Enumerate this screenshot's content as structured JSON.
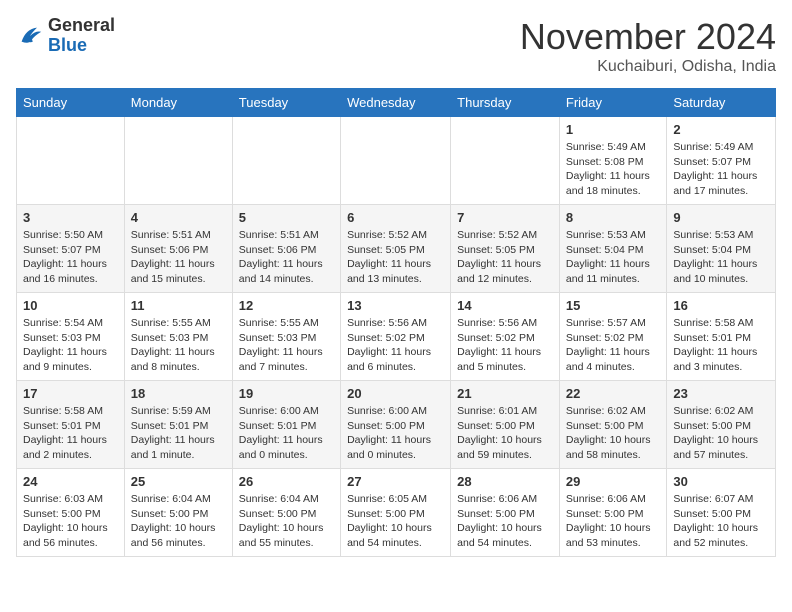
{
  "header": {
    "logo_general": "General",
    "logo_blue": "Blue",
    "month": "November 2024",
    "location": "Kuchaiburi, Odisha, India"
  },
  "days_of_week": [
    "Sunday",
    "Monday",
    "Tuesday",
    "Wednesday",
    "Thursday",
    "Friday",
    "Saturday"
  ],
  "weeks": [
    [
      {
        "day": "",
        "info": ""
      },
      {
        "day": "",
        "info": ""
      },
      {
        "day": "",
        "info": ""
      },
      {
        "day": "",
        "info": ""
      },
      {
        "day": "",
        "info": ""
      },
      {
        "day": "1",
        "info": "Sunrise: 5:49 AM\nSunset: 5:08 PM\nDaylight: 11 hours and 18 minutes."
      },
      {
        "day": "2",
        "info": "Sunrise: 5:49 AM\nSunset: 5:07 PM\nDaylight: 11 hours and 17 minutes."
      }
    ],
    [
      {
        "day": "3",
        "info": "Sunrise: 5:50 AM\nSunset: 5:07 PM\nDaylight: 11 hours and 16 minutes."
      },
      {
        "day": "4",
        "info": "Sunrise: 5:51 AM\nSunset: 5:06 PM\nDaylight: 11 hours and 15 minutes."
      },
      {
        "day": "5",
        "info": "Sunrise: 5:51 AM\nSunset: 5:06 PM\nDaylight: 11 hours and 14 minutes."
      },
      {
        "day": "6",
        "info": "Sunrise: 5:52 AM\nSunset: 5:05 PM\nDaylight: 11 hours and 13 minutes."
      },
      {
        "day": "7",
        "info": "Sunrise: 5:52 AM\nSunset: 5:05 PM\nDaylight: 11 hours and 12 minutes."
      },
      {
        "day": "8",
        "info": "Sunrise: 5:53 AM\nSunset: 5:04 PM\nDaylight: 11 hours and 11 minutes."
      },
      {
        "day": "9",
        "info": "Sunrise: 5:53 AM\nSunset: 5:04 PM\nDaylight: 11 hours and 10 minutes."
      }
    ],
    [
      {
        "day": "10",
        "info": "Sunrise: 5:54 AM\nSunset: 5:03 PM\nDaylight: 11 hours and 9 minutes."
      },
      {
        "day": "11",
        "info": "Sunrise: 5:55 AM\nSunset: 5:03 PM\nDaylight: 11 hours and 8 minutes."
      },
      {
        "day": "12",
        "info": "Sunrise: 5:55 AM\nSunset: 5:03 PM\nDaylight: 11 hours and 7 minutes."
      },
      {
        "day": "13",
        "info": "Sunrise: 5:56 AM\nSunset: 5:02 PM\nDaylight: 11 hours and 6 minutes."
      },
      {
        "day": "14",
        "info": "Sunrise: 5:56 AM\nSunset: 5:02 PM\nDaylight: 11 hours and 5 minutes."
      },
      {
        "day": "15",
        "info": "Sunrise: 5:57 AM\nSunset: 5:02 PM\nDaylight: 11 hours and 4 minutes."
      },
      {
        "day": "16",
        "info": "Sunrise: 5:58 AM\nSunset: 5:01 PM\nDaylight: 11 hours and 3 minutes."
      }
    ],
    [
      {
        "day": "17",
        "info": "Sunrise: 5:58 AM\nSunset: 5:01 PM\nDaylight: 11 hours and 2 minutes."
      },
      {
        "day": "18",
        "info": "Sunrise: 5:59 AM\nSunset: 5:01 PM\nDaylight: 11 hours and 1 minute."
      },
      {
        "day": "19",
        "info": "Sunrise: 6:00 AM\nSunset: 5:01 PM\nDaylight: 11 hours and 0 minutes."
      },
      {
        "day": "20",
        "info": "Sunrise: 6:00 AM\nSunset: 5:00 PM\nDaylight: 11 hours and 0 minutes."
      },
      {
        "day": "21",
        "info": "Sunrise: 6:01 AM\nSunset: 5:00 PM\nDaylight: 10 hours and 59 minutes."
      },
      {
        "day": "22",
        "info": "Sunrise: 6:02 AM\nSunset: 5:00 PM\nDaylight: 10 hours and 58 minutes."
      },
      {
        "day": "23",
        "info": "Sunrise: 6:02 AM\nSunset: 5:00 PM\nDaylight: 10 hours and 57 minutes."
      }
    ],
    [
      {
        "day": "24",
        "info": "Sunrise: 6:03 AM\nSunset: 5:00 PM\nDaylight: 10 hours and 56 minutes."
      },
      {
        "day": "25",
        "info": "Sunrise: 6:04 AM\nSunset: 5:00 PM\nDaylight: 10 hours and 56 minutes."
      },
      {
        "day": "26",
        "info": "Sunrise: 6:04 AM\nSunset: 5:00 PM\nDaylight: 10 hours and 55 minutes."
      },
      {
        "day": "27",
        "info": "Sunrise: 6:05 AM\nSunset: 5:00 PM\nDaylight: 10 hours and 54 minutes."
      },
      {
        "day": "28",
        "info": "Sunrise: 6:06 AM\nSunset: 5:00 PM\nDaylight: 10 hours and 54 minutes."
      },
      {
        "day": "29",
        "info": "Sunrise: 6:06 AM\nSunset: 5:00 PM\nDaylight: 10 hours and 53 minutes."
      },
      {
        "day": "30",
        "info": "Sunrise: 6:07 AM\nSunset: 5:00 PM\nDaylight: 10 hours and 52 minutes."
      }
    ]
  ]
}
